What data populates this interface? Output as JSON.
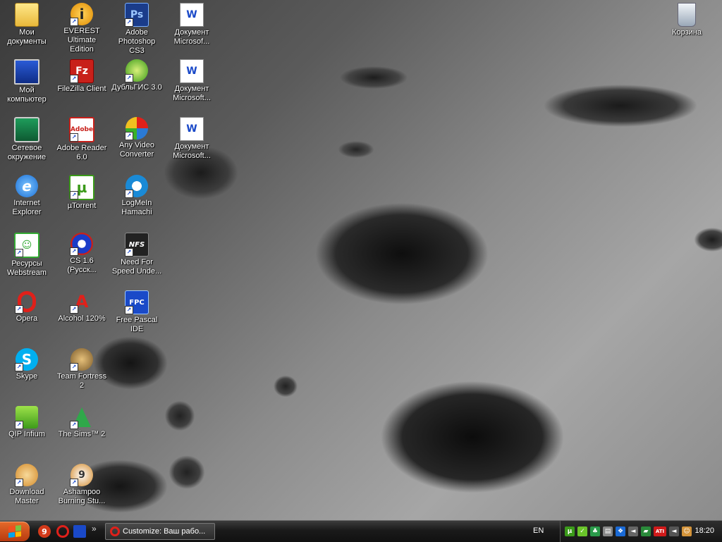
{
  "desktop": {
    "icons": [
      {
        "label": "Мои документы"
      },
      {
        "label": "Мой компьютер"
      },
      {
        "label": "Сетевое окружение"
      },
      {
        "label": "Internet Explorer"
      },
      {
        "label": "Ресурсы Webstream"
      },
      {
        "label": "Opera"
      },
      {
        "label": "Skype"
      },
      {
        "label": "QIP Infium"
      },
      {
        "label": "Download Master"
      },
      {
        "label": "EVEREST Ultimate Edition"
      },
      {
        "label": "FileZilla Client"
      },
      {
        "label": "Adobe Reader 6.0"
      },
      {
        "label": "µTorrent"
      },
      {
        "label": "CS 1.6 (Русск..."
      },
      {
        "label": "Alcohol 120%"
      },
      {
        "label": "Team Fortress 2"
      },
      {
        "label": "The Sims™ 2"
      },
      {
        "label": "Ashampoo Burning Stu..."
      },
      {
        "label": "Adobe Photoshop CS3"
      },
      {
        "label": "ДубльГИС 3.0"
      },
      {
        "label": "Any Video Converter"
      },
      {
        "label": "LogMeIn Hamachi"
      },
      {
        "label": "Need For Speed Unde..."
      },
      {
        "label": "Free Pascal IDE"
      },
      {
        "label": "Документ Microsof..."
      },
      {
        "label": "Документ Microsoft..."
      },
      {
        "label": "Документ Microsoft..."
      },
      {
        "label": "Корзина"
      }
    ],
    "icon_glyphs": {
      "everest": "i",
      "filezilla": "Fz",
      "photoshop": "Ps",
      "utorrent": "µ",
      "word": "W",
      "alcohol": "A",
      "pascal": "FPC",
      "nfs": "NFS",
      "opera": "O",
      "skype": "S",
      "ie": "e"
    }
  },
  "taskbar": {
    "quick_launch": [
      "9",
      "O",
      "▮"
    ],
    "more": "»",
    "task_title": "Customize: Ваш рабо...",
    "language": "EN",
    "clock": "18:20",
    "tray_glyphs": [
      "µ",
      "✓",
      "♣",
      "▤",
      "❖",
      "◄",
      "▰",
      "ATI",
      "◄",
      "☺"
    ]
  },
  "colors": {
    "start": "#c94c1a",
    "taskbar": "#1a1a1a"
  }
}
